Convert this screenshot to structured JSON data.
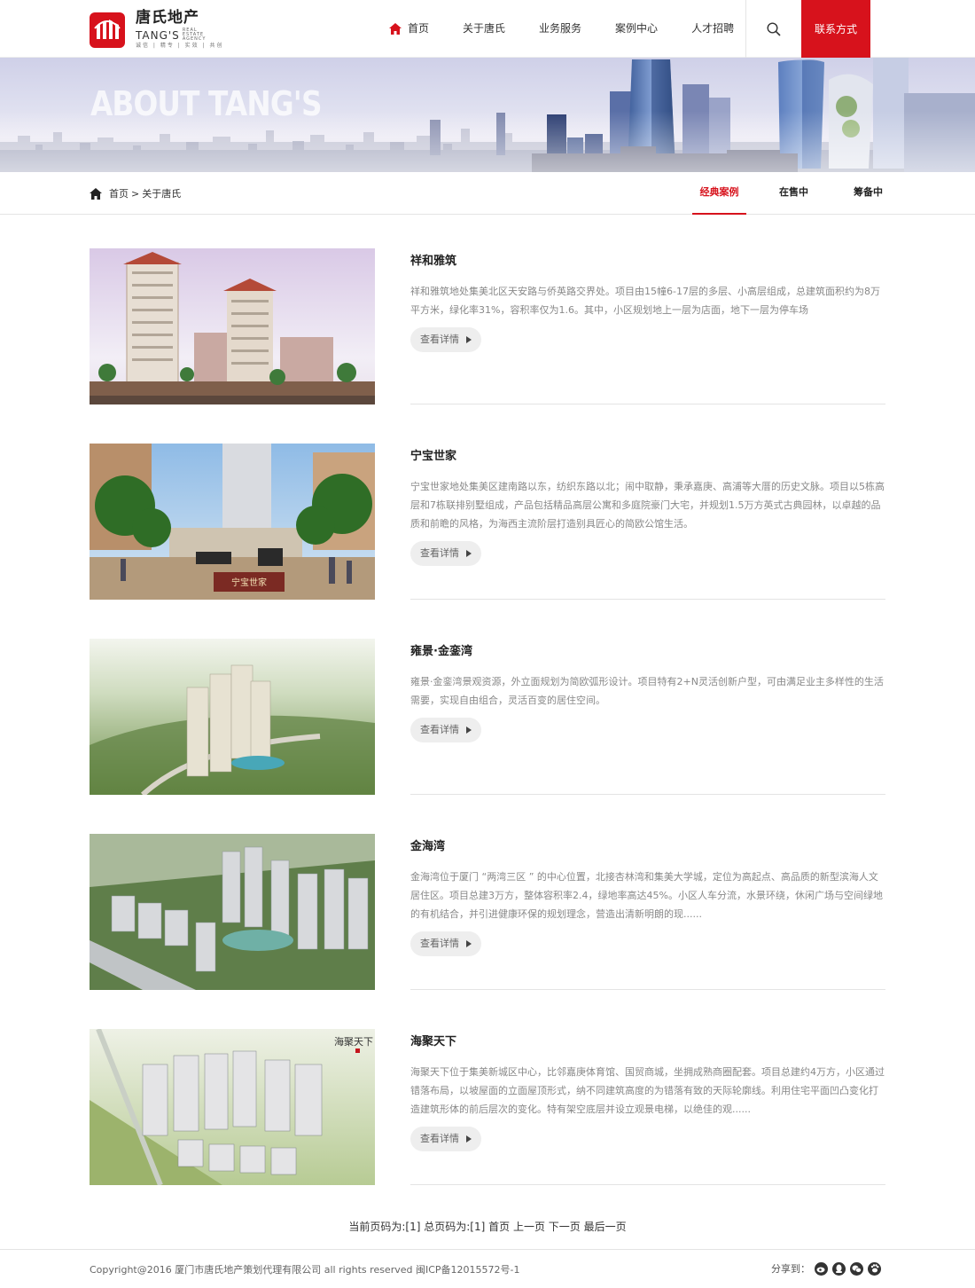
{
  "header": {
    "logo": {
      "name_cn": "唐氏地产",
      "name_en": "TANG'S",
      "en_sub": "REAL ESTATE AGENCY",
      "slogan": "诚信 | 精专 | 实效 | 共创"
    },
    "nav": [
      {
        "label": "首页",
        "icon": "home-icon"
      },
      {
        "label": "关于唐氏"
      },
      {
        "label": "业务服务"
      },
      {
        "label": "案例中心"
      },
      {
        "label": "人才招聘"
      }
    ],
    "search_icon": "search-icon",
    "contact_label": "联系方式"
  },
  "banner": {
    "title": "ABOUT TANG'S"
  },
  "breadcrumb": {
    "home": "首页",
    "sep": ">",
    "current": "关于唐氏"
  },
  "tabs": [
    {
      "label": "经典案例",
      "active": true
    },
    {
      "label": "在售中",
      "active": false
    },
    {
      "label": "筹备中",
      "active": false
    }
  ],
  "projects": [
    {
      "title": "祥和雅筑",
      "desc": "祥和雅筑地处集美北区天安路与侨英路交界处。项目由15幢6-17层的多层、小高层组成，总建筑面积约为8万平方米，绿化率31%，容积率仅为1.6。其中，小区规划地上一层为店面，地下一层为停车场",
      "button": "查看详情"
    },
    {
      "title": "宁宝世家",
      "desc": "宁宝世家地处集美区建南路以东，纺织东路以北；闹中取静，秉承嘉庚、高浦等大厝的历史文脉。项目以5栋高层和7栋联排别墅组成，产品包括精品高层公寓和多庭院豪门大宅，并规划1.5万方英式古典园林，以卓越的品质和前瞻的风格，为海西主流阶层打造别具匠心的简欧公馆生活。",
      "button": "查看详情",
      "plaque": "宁宝世家"
    },
    {
      "title": "雍景·金銮湾",
      "desc": "雍景·金銮湾景观资源，外立面规划为简欧弧形设计。项目特有2+N灵活创新户型，可由满足业主多样性的生活需要，实现自由组合，灵活百变的居住空间。",
      "button": "查看详情"
    },
    {
      "title": "金海湾",
      "desc": "金海湾位于厦门 “两湾三区 ” 的中心位置，北接杏林湾和集美大学城，定位为高起点、高品质的新型滨海人文居住区。项目总建3万方，整体容积率2.4，绿地率高达45%。小区人车分流，水景环绕，休闲广场与空间绿地的有机结合，并引进健康环保的规划理念，营造出清新明朗的现......",
      "button": "查看详情"
    },
    {
      "title": "海聚天下",
      "desc": "海聚天下位于集美新城区中心，比邻嘉庚体育馆、国贸商城，坐拥成熟商圈配套。项目总建约4万方，小区通过错落布局，以坡屋面的立面屋顶形式，纳不同建筑高度的为错落有致的天际轮廓线。利用住宅平面凹凸变化打造建筑形体的前后层次的变化。特有架空底层并设立观景电梯，以绝佳的观......",
      "button": "查看详情",
      "calligraphy": "海聚天下"
    }
  ],
  "pager": {
    "current_text": "当前页码为:[1]",
    "total_text": "总页码为:[1]",
    "first": "首页",
    "prev": "上一页",
    "next": "下一页",
    "last": "最后一页"
  },
  "footer": {
    "copyright": "Copyright@2016 厦门市唐氏地产策划代理有限公司 all rights reserved 闽ICP备12015572号-1",
    "share_label": "分享到：",
    "share_icons": [
      "weibo-icon",
      "qq-icon",
      "wechat-icon",
      "baidu-icon"
    ]
  },
  "colors": {
    "accent": "#d7121c",
    "text": "#333333",
    "muted": "#888888"
  }
}
